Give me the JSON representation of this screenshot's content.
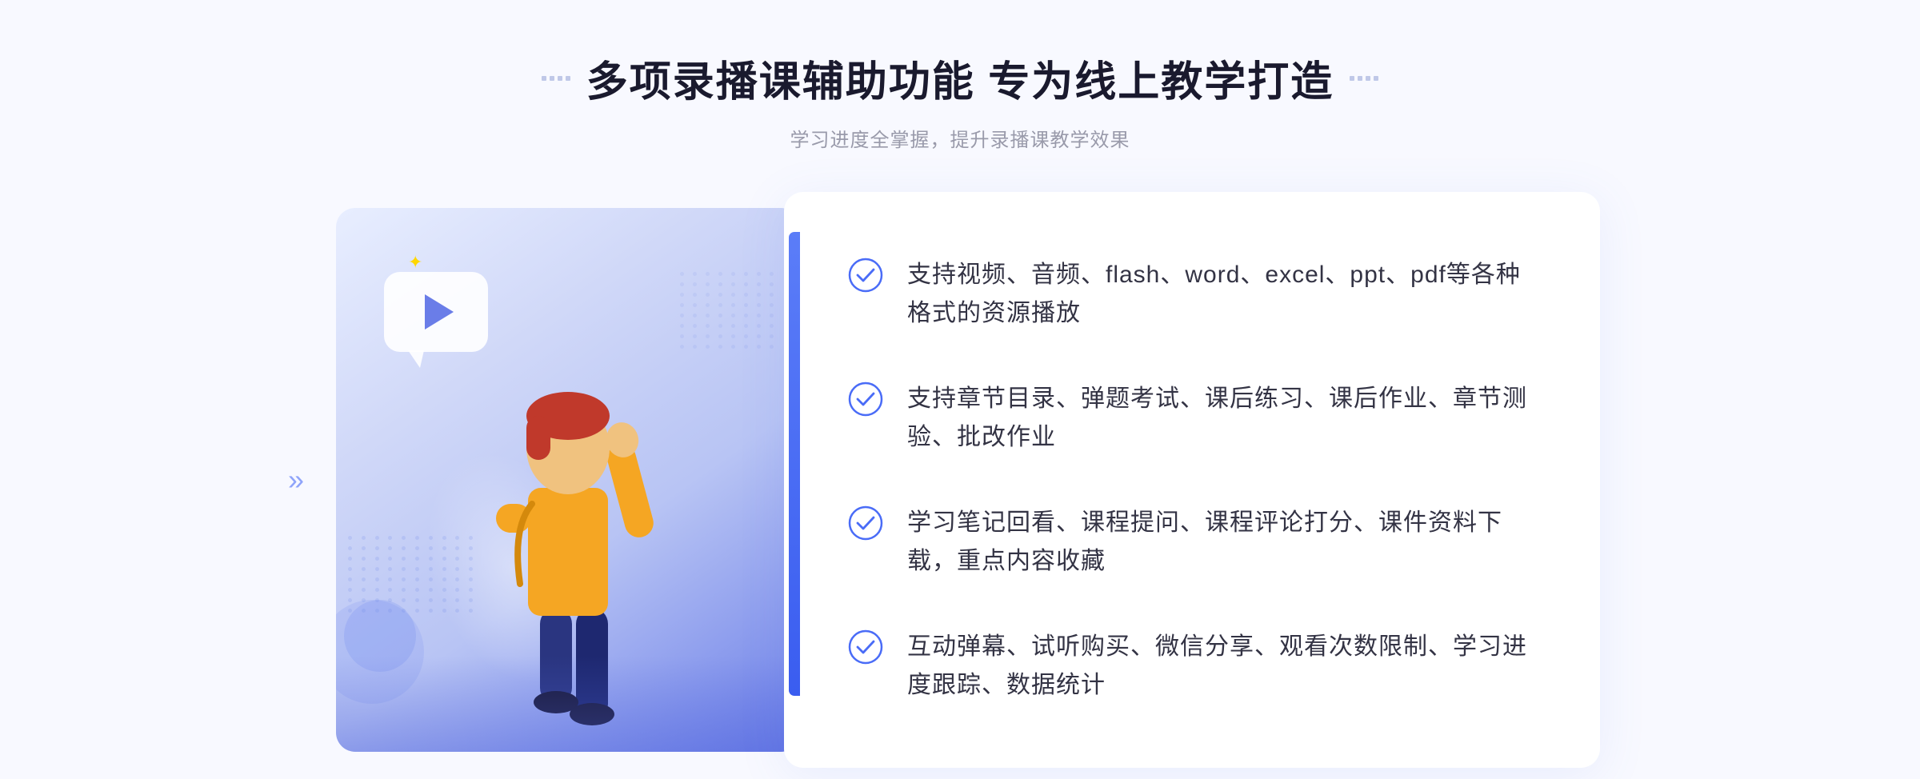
{
  "header": {
    "title": "多项录播课辅助功能 专为线上教学打造",
    "subtitle": "学习进度全掌握，提升录播课教学效果",
    "title_decorator_count": 4
  },
  "features": [
    {
      "id": 1,
      "text": "支持视频、音频、flash、word、excel、ppt、pdf等各种格式的资源播放"
    },
    {
      "id": 2,
      "text": "支持章节目录、弹题考试、课后练习、课后作业、章节测验、批改作业"
    },
    {
      "id": 3,
      "text": "学习笔记回看、课程提问、课程评论打分、课件资料下载，重点内容收藏"
    },
    {
      "id": 4,
      "text": "互动弹幕、试听购买、微信分享、观看次数限制、学习进度跟踪、数据统计"
    }
  ],
  "colors": {
    "primary": "#4a6cf7",
    "primary_light": "#6a7de8",
    "title": "#1a1a2e",
    "subtitle": "#999aaa",
    "feature_text": "#333344",
    "check_icon": "#4a6cf7",
    "bg": "#f8f9ff"
  },
  "icons": {
    "check_circle": "✓",
    "double_arrow": "»",
    "play": "▶"
  }
}
